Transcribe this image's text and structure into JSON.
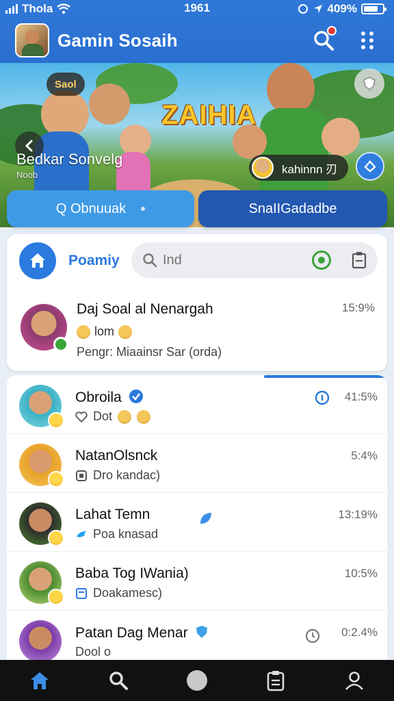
{
  "status_bar": {
    "carrier": "Thola",
    "time": "1961",
    "battery": "409%"
  },
  "header": {
    "app_title": "Gamin Sosaih"
  },
  "banner": {
    "pill_text": "Saol",
    "title": "ZAIHIA",
    "name": "Bedkar Sonvelg",
    "subtitle": "Noob",
    "user_badge": "kahinnn 刃"
  },
  "tabs": [
    {
      "label": "Q Obnuuak"
    },
    {
      "label": "SnaIIGadadbe"
    }
  ],
  "card": {
    "home_label": "Poamiy",
    "search_placeholder": "Ind",
    "featured": {
      "name": "Daj Soal al Nenargah",
      "time": "15:9%",
      "line2": "lom",
      "line3": "Pengr: Miaainsr Sar (orda)"
    }
  },
  "chats": [
    {
      "name": "Obroila",
      "preview": "Dot",
      "time": "41:5%"
    },
    {
      "name": "NatanOlsnck",
      "preview": "Dro kandac)",
      "time": "5:4%"
    },
    {
      "name": "Lahat Temn",
      "preview": "Poa knasad",
      "time": "13:19%"
    },
    {
      "name": "Baba Tog IWania)",
      "preview": "Doakamesc)",
      "time": "10:5%"
    },
    {
      "name": "Patan Dag Menar",
      "preview": "Dool o",
      "time": "0:2.4%"
    }
  ],
  "colors": {
    "primary": "#2f78d8",
    "accent_dark": "#2358b0",
    "tab_light": "#3f9ae6",
    "online": "#3aa33a"
  },
  "icons": [
    "search-icon",
    "more-icon",
    "home-icon",
    "clipboard-icon",
    "profile-icon",
    "verified-icon"
  ]
}
